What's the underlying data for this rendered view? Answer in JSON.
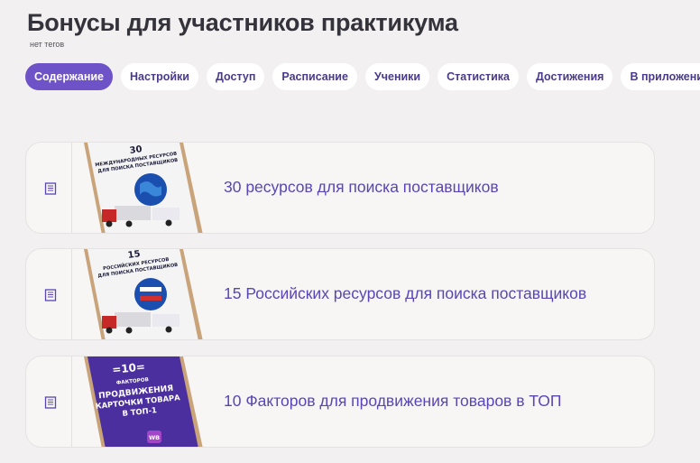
{
  "page": {
    "title": "Бонусы для участников практикума",
    "tags": "нет тегов"
  },
  "tabs": [
    {
      "label": "Содержание",
      "active": true
    },
    {
      "label": "Настройки"
    },
    {
      "label": "Доступ"
    },
    {
      "label": "Расписание"
    },
    {
      "label": "Ученики"
    },
    {
      "label": "Статистика"
    },
    {
      "label": "Достижения"
    },
    {
      "label": "В приложении"
    }
  ],
  "items": [
    {
      "title": "30 ресурсов для поиска поставщиков",
      "cover": {
        "line1": "30",
        "line2": "МЕЖДУНАРОДНЫХ РЕСУРСОВ",
        "line3": "ДЛЯ ПОИСКА ПОСТАВЩИКОВ"
      }
    },
    {
      "title": "15 Российских ресурсов для поиска поставщиков",
      "cover": {
        "line1": "15",
        "line2": "РОССИЙСКИХ РЕСУРСОВ",
        "line3": "ДЛЯ ПОИСКА ПОСТАВЩИКОВ"
      }
    },
    {
      "title": "10 Факторов для продвижения товаров в ТОП",
      "cover": {
        "line1": "=10=",
        "line2": "ФАКТОРОВ",
        "line3": "ПРОДВИЖЕНИЯ",
        "line4": "КАРТОЧКИ ТОВАРА",
        "line5": "В ТОП-1",
        "badge": "WB"
      }
    }
  ],
  "colors": {
    "accent": "#6e52c7",
    "link": "#5b45b6",
    "background": "#f2f0f0",
    "card": "#f7f6f5"
  },
  "icons": {
    "list_item": "document-icon"
  }
}
